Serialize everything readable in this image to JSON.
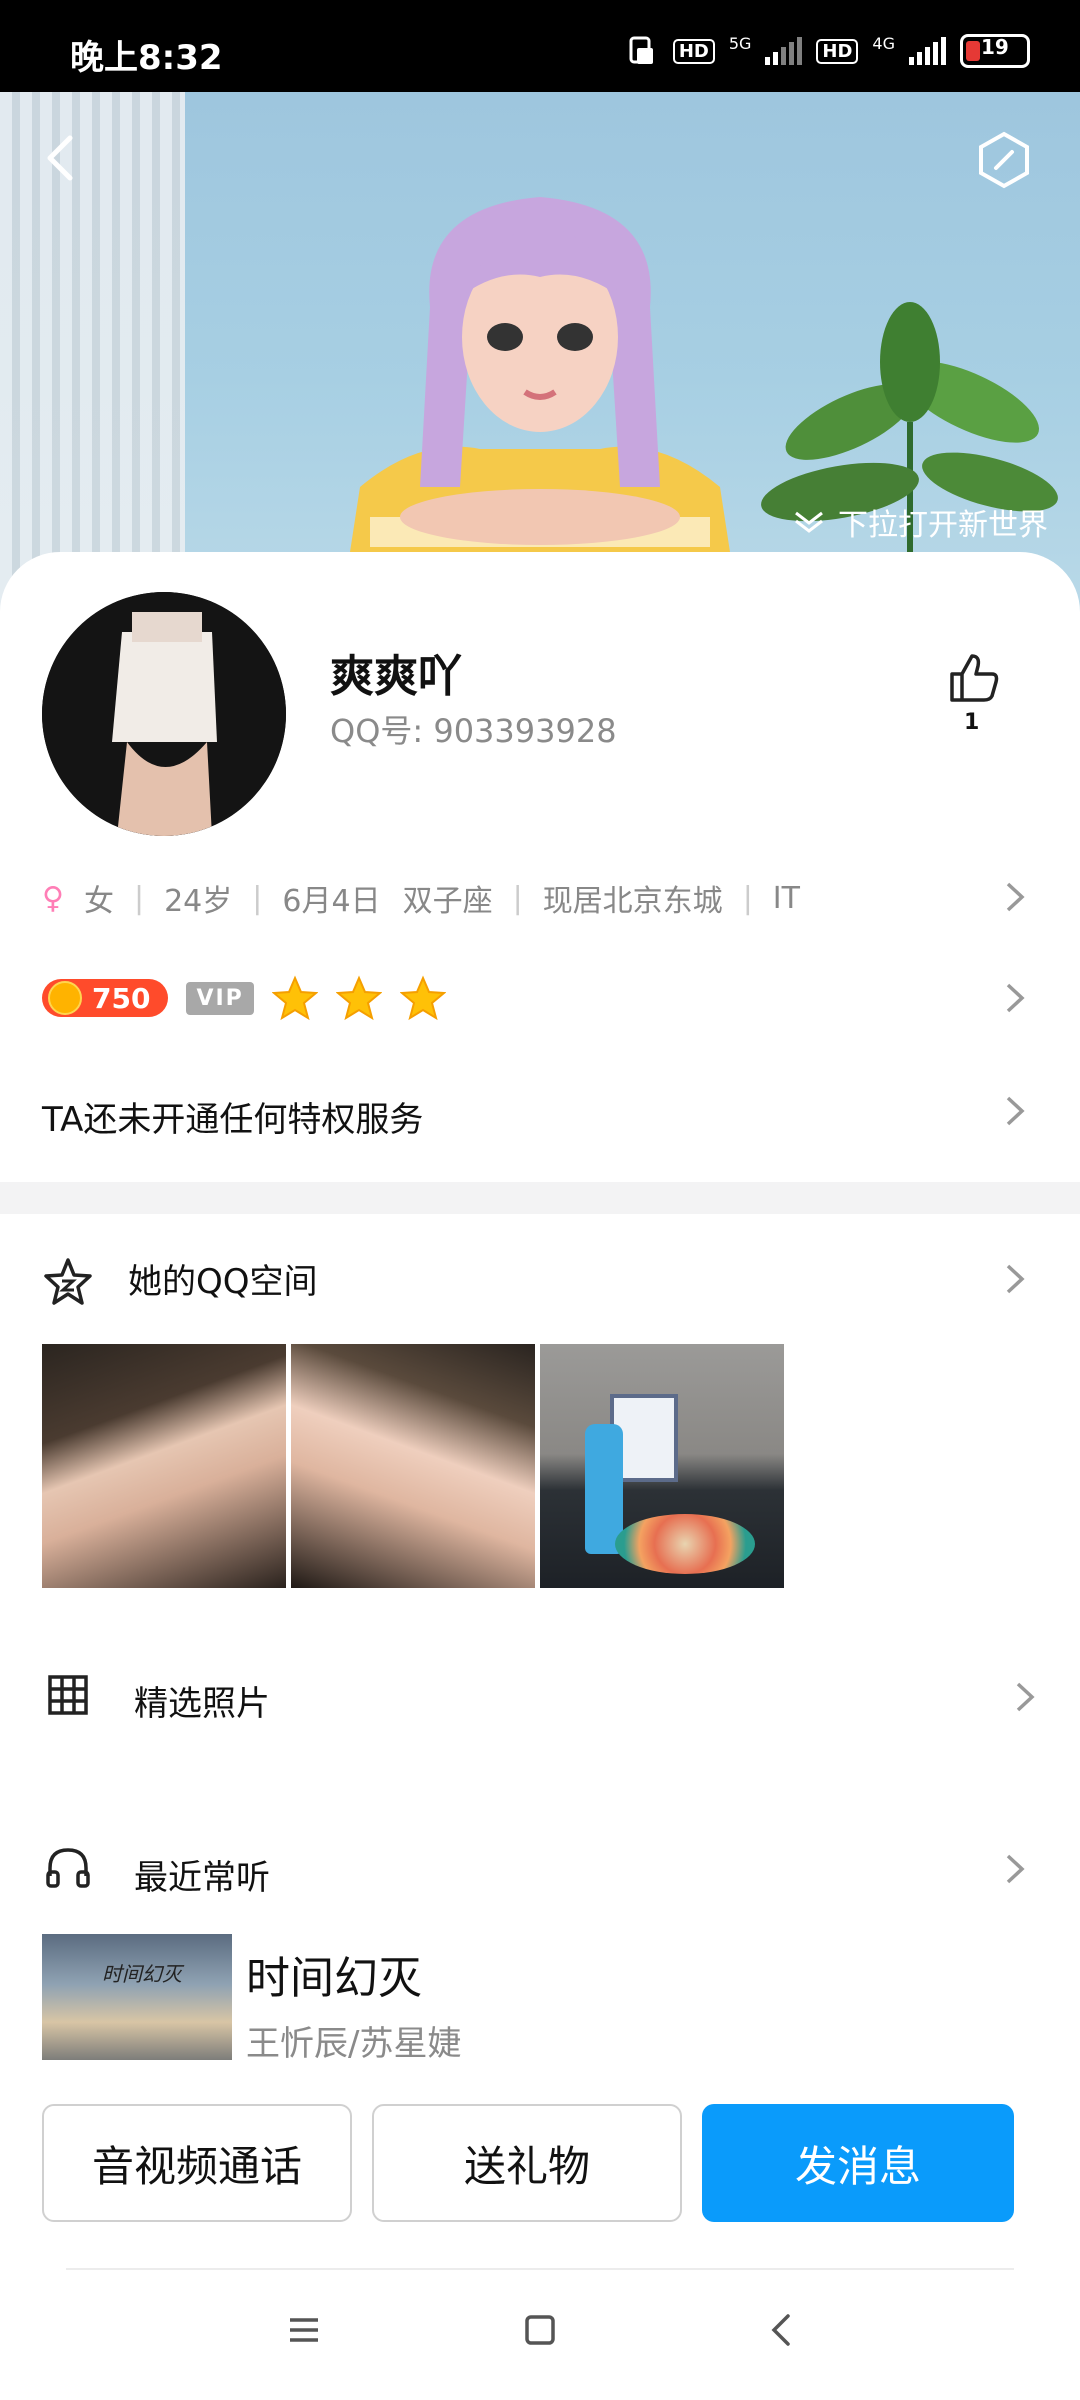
{
  "status_bar": {
    "time": "晚上8:32",
    "hd1": "HD",
    "net1": "5G",
    "hd2": "HD",
    "net2": "4G",
    "battery": "19"
  },
  "banner": {
    "pull_hint": "下拉打开新世界"
  },
  "profile": {
    "nickname": "爽爽吖",
    "qq_number": "QQ号: 903393928",
    "like_count": "1",
    "gender": "女",
    "age": "24岁",
    "birthday": "6月4日",
    "zodiac": "双子座",
    "location": "现居北京东城",
    "occupation": "IT",
    "level_points": "750",
    "vip_label": "VIP",
    "stars": 3,
    "privilege_text": "TA还未开通任何特权服务"
  },
  "qzone": {
    "title": "她的QQ空间",
    "photo_count": 3
  },
  "selected_photos": {
    "title": "精选照片"
  },
  "recent_music": {
    "title": "最近常听",
    "album_text": "时间幻灭",
    "song": "时间幻灭",
    "artist": "王忻辰/苏星婕"
  },
  "actions": {
    "call": "音视频通话",
    "gift": "送礼物",
    "message": "发消息"
  },
  "colors": {
    "accent": "#0a9bfb",
    "coin": "#ff4b2b",
    "vip_gray": "#a8a8a8",
    "gender_pink": "#ff7eb6"
  }
}
